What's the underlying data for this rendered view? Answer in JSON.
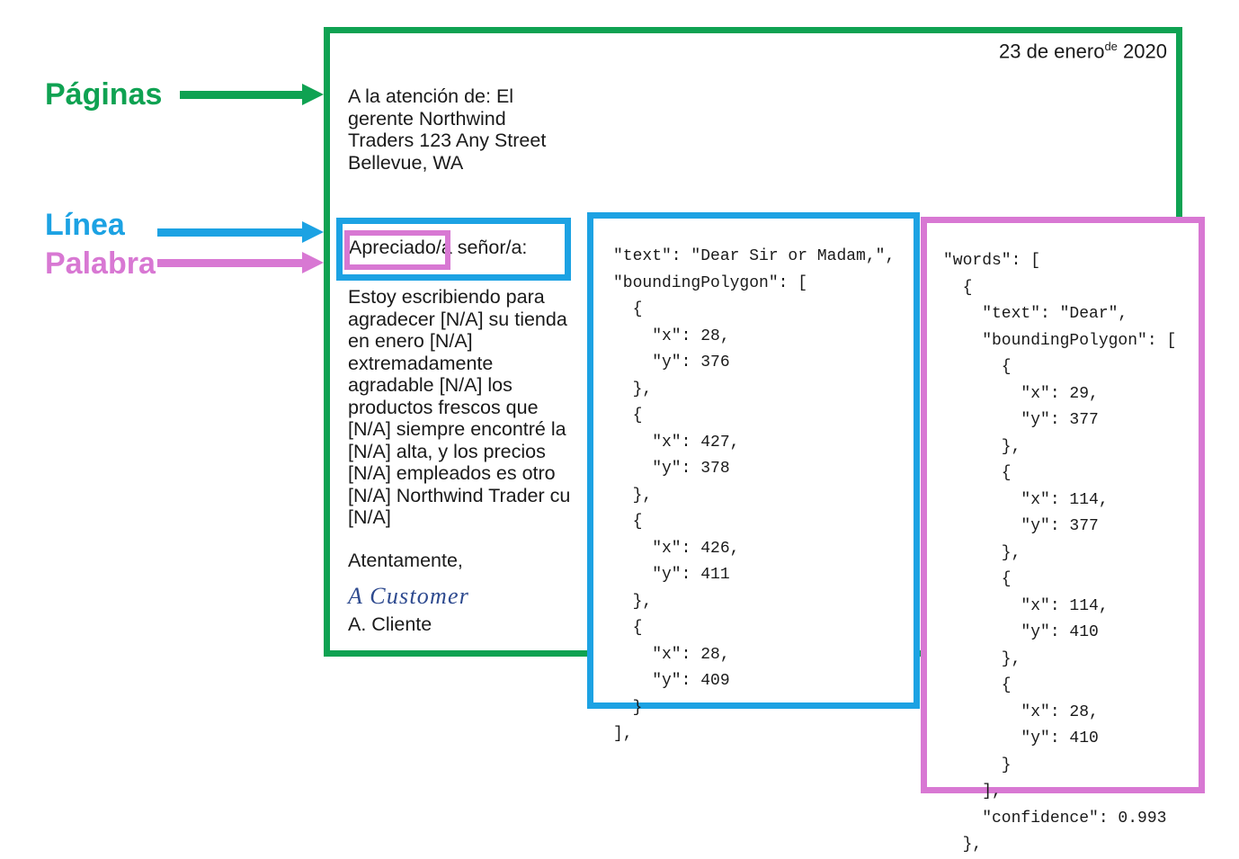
{
  "legend": {
    "items": [
      {
        "label": "Páginas",
        "color": "#0FA252",
        "arrow": "green-arrow"
      },
      {
        "label": "Línea",
        "color": "#1CA2E3",
        "arrow": "blue-arrow"
      },
      {
        "label": "Palabra",
        "color": "#D878D3",
        "arrow": "pink-arrow"
      }
    ]
  },
  "document": {
    "date": "23 de enero",
    "date_superscript": "de",
    "date_year": "2020",
    "address": "A la atención de: El gerente Northwind Traders 123 Any Street Bellevue, WA",
    "greeting": "Apreciado/a señor/a:",
    "greeting_word_highlighted": "Apreciado",
    "body": "Estoy escribiendo para agradecer [N/A] su tienda en enero [N/A] extremadamente agradable [N/A] los productos frescos que [N/A] siempre encontré la [N/A] alta, y los precios [N/A] empleados es otro [N/A] Northwind Trader cu [N/A]",
    "closing": "Atentamente,",
    "signature": "A Customer",
    "signature_name": "A. Cliente"
  },
  "json_line_panel": {
    "border_color": "#1CA2E3",
    "code": "\"text\": \"Dear Sir or Madam,\",\n\"boundingPolygon\": [\n  {\n    \"x\": 28,\n    \"y\": 376\n  },\n  {\n    \"x\": 427,\n    \"y\": 378\n  },\n  {\n    \"x\": 426,\n    \"y\": 411\n  },\n  {\n    \"x\": 28,\n    \"y\": 409\n  }\n],"
  },
  "json_word_panel": {
    "border_color": "#D878D3",
    "code": "\"words\": [\n  {\n    \"text\": \"Dear\",\n    \"boundingPolygon\": [\n      {\n        \"x\": 29,\n        \"y\": 377\n      },\n      {\n        \"x\": 114,\n        \"y\": 377\n      },\n      {\n        \"x\": 114,\n        \"y\": 410\n      },\n      {\n        \"x\": 28,\n        \"y\": 410\n      }\n    ],\n    \"confidence\": 0.993\n  },"
  },
  "json_hidden_panel": {
    "code": "\"\n\"\n\"\n\n\n\n\n\"\n\"\n\"c"
  },
  "colors": {
    "page_green": "#0FA252",
    "line_blue": "#1CA2E3",
    "word_pink": "#D878D3",
    "signature_blue": "#2E4A8F",
    "text_black": "#1a1a1a"
  }
}
